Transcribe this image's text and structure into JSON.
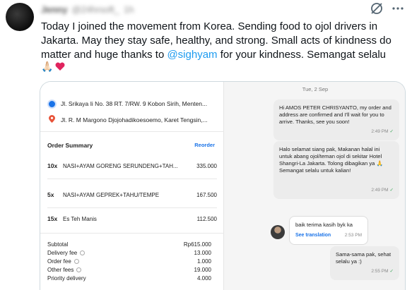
{
  "tweet": {
    "author_name": "Jenny",
    "author_handle": "@24hrsoft_",
    "time": "1h",
    "text_before": "Today I joined the movement from Korea. Sending food to ojol drivers in Jakarta. May they stay safe, healthy, and strong. Small acts of kindness do matter and huge thanks to ",
    "mention": "@sighyam",
    "text_after": " for your kindness. Semangat selalu",
    "emojis": [
      "🙏🏻",
      "❤️"
    ],
    "icons": [
      "grok-icon",
      "more-icon"
    ]
  },
  "order": {
    "pickup_address": "Jl. Srikaya Ii No. 38 RT. 7/RW. 9 Kobon Sirih, Menten...",
    "dropoff_address": "Jl. R. M Margono Djojohadikoesoemo, Karet Tengsin,...",
    "summary_title": "Order Summary",
    "reorder_label": "Reorder",
    "items": [
      {
        "qty": "10x",
        "name": "NASI+AYAM GORENG SERUNDENG+TAH...",
        "price": "335.000"
      },
      {
        "qty": "5x",
        "name": "NASI+AYAM GEPREK+TAHU/TEMPE",
        "price": "167.500"
      },
      {
        "qty": "15x",
        "name": "Es Teh Manis",
        "price": "112.500"
      }
    ],
    "fees": [
      {
        "label": "Subtotal",
        "value": "Rp615.000",
        "info": false
      },
      {
        "label": "Delivery fee",
        "value": "13.000",
        "info": true
      },
      {
        "label": "Order fee",
        "value": "1.000",
        "info": true
      },
      {
        "label": "Other fees",
        "value": "19.000",
        "info": true
      },
      {
        "label": "Priority delivery",
        "value": "4.000",
        "info": false
      }
    ]
  },
  "chat": {
    "date": "Tue, 2 Sep",
    "messages": [
      {
        "dir": "out",
        "text": "Hi AMOS PETER CHRISYANTO, my order and address are confirmed and I'll wait for you to arrive. Thanks, see you soon!",
        "time": "2:49 PM"
      },
      {
        "dir": "out",
        "text": "Halo selamat siang pak, Makanan halal ini untuk abang ojol/teman ojol di sekitar Hotel Shangri-La Jakarta. Tolong dibagikan ya 🙏 Semangat selalu untuk kalian!",
        "time": "2:49 PM"
      },
      {
        "dir": "in",
        "text": "baik terima kasih byk ka",
        "translate": "See translation",
        "time": "2:53 PM"
      },
      {
        "dir": "out",
        "text": "Sama-sama pak, sehat selalu ya :)",
        "time": "2:55 PM"
      }
    ],
    "colors": {
      "bubble_out": "#ececec",
      "bubble_in": "#ffffff",
      "tick": "#3aa757",
      "link": "#1a73e8"
    }
  },
  "colors": {
    "mention": "#1d9bf0",
    "pickup_dot": "#1a73e8",
    "dropoff_dot": "#e8543a"
  }
}
